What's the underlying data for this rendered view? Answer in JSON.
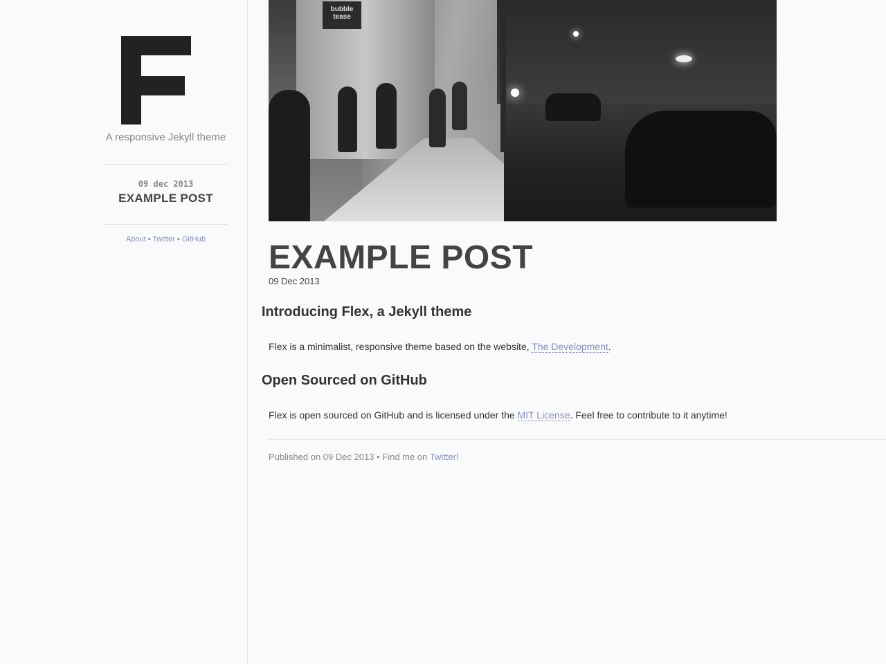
{
  "sidebar": {
    "logo_letter": "F",
    "tagline": "A responsive Jekyll theme",
    "post_date": "09 dec 2013",
    "post_title": "EXAMPLE POST",
    "links": [
      {
        "label": "About"
      },
      {
        "label": "Twitter"
      },
      {
        "label": "GitHub"
      }
    ],
    "separator": "•"
  },
  "hero": {
    "sign_text": "bubble tease"
  },
  "post": {
    "title": "EXAMPLE POST",
    "date": "09 Dec 2013",
    "sections": [
      {
        "heading": "Introducing Flex, a Jekyll theme",
        "text_before": "Flex is a minimalist, responsive theme based on the website, ",
        "link": "The Development",
        "text_after": "."
      },
      {
        "heading": "Open Sourced on GitHub",
        "text_before": "Flex is open sourced on GitHub and is licensed under the ",
        "link": "MIT License",
        "text_after": ". Feel free to contribute to it anytime!"
      }
    ]
  },
  "footer": {
    "text_before": "Published on 09 Dec 2013 • Find me on ",
    "link": "Twitter",
    "text_after": "!"
  },
  "colors": {
    "background": "#f9fafc",
    "link": "#8a8db3",
    "text": "#333333",
    "logo": "#222222"
  }
}
